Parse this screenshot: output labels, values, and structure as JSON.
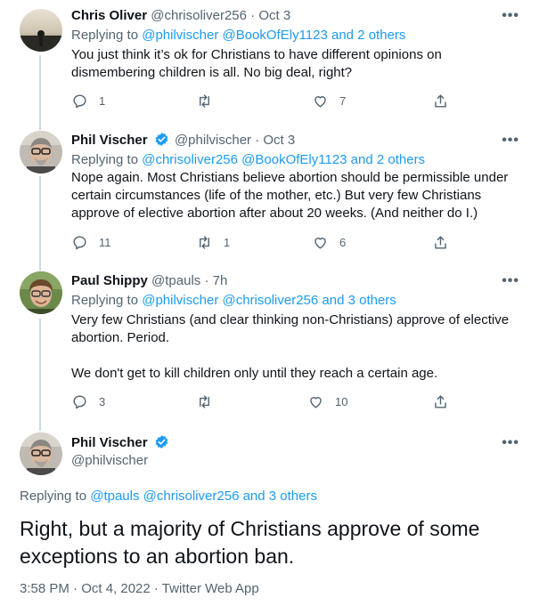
{
  "tweets": [
    {
      "name": "Chris Oliver",
      "handle": "@chrisoliver256",
      "sep": "·",
      "time": "Oct 3",
      "replying_label": "Replying to",
      "replying_mentions": "@philvischer @BookOfEly1123 and 2 others",
      "text": "You just think it’s ok for Christians to have different opinions on dismembering children is all. No big deal, right?",
      "reply_count": "1",
      "retweet_count": "",
      "like_count": "7",
      "verified": false
    },
    {
      "name": "Phil Vischer",
      "handle": "@philvischer",
      "sep": "·",
      "time": "Oct 3",
      "replying_label": "Replying to",
      "replying_mentions": "@chrisoliver256 @BookOfEly1123 and 2 others",
      "text": "Nope again.  Most Christians believe abortion should be permissible under certain circumstances (life of the mother, etc.)  But very few Christians approve of elective abortion after about 20 weeks.  (And neither do I.)",
      "reply_count": "11",
      "retweet_count": "1",
      "like_count": "6",
      "verified": true
    },
    {
      "name": "Paul Shippy",
      "handle": "@tpauls",
      "sep": "·",
      "time": "7h",
      "replying_label": "Replying to",
      "replying_mentions": "@philvischer @chrisoliver256 and 3 others",
      "text": "Very few Christians (and clear thinking non-Christians) approve of elective abortion. Period.\n\nWe don't get to kill children only until they reach a certain age.",
      "reply_count": "3",
      "retweet_count": "",
      "like_count": "10",
      "verified": false
    }
  ],
  "main_tweet": {
    "name": "Phil Vischer",
    "handle": "@philvischer",
    "verified": true,
    "replying_label": "Replying to",
    "replying_mentions": "@tpauls @chrisoliver256 and 3 others",
    "text": "Right, but a majority of Christians approve of some exceptions to an abortion ban.",
    "meta": "3:58 PM · Oct 4, 2022 · Twitter Web App"
  },
  "more_label": "•••",
  "colors": {
    "accent": "#1d9bf0",
    "muted": "#536471",
    "text": "#0f1419",
    "line": "#cfd9de"
  }
}
